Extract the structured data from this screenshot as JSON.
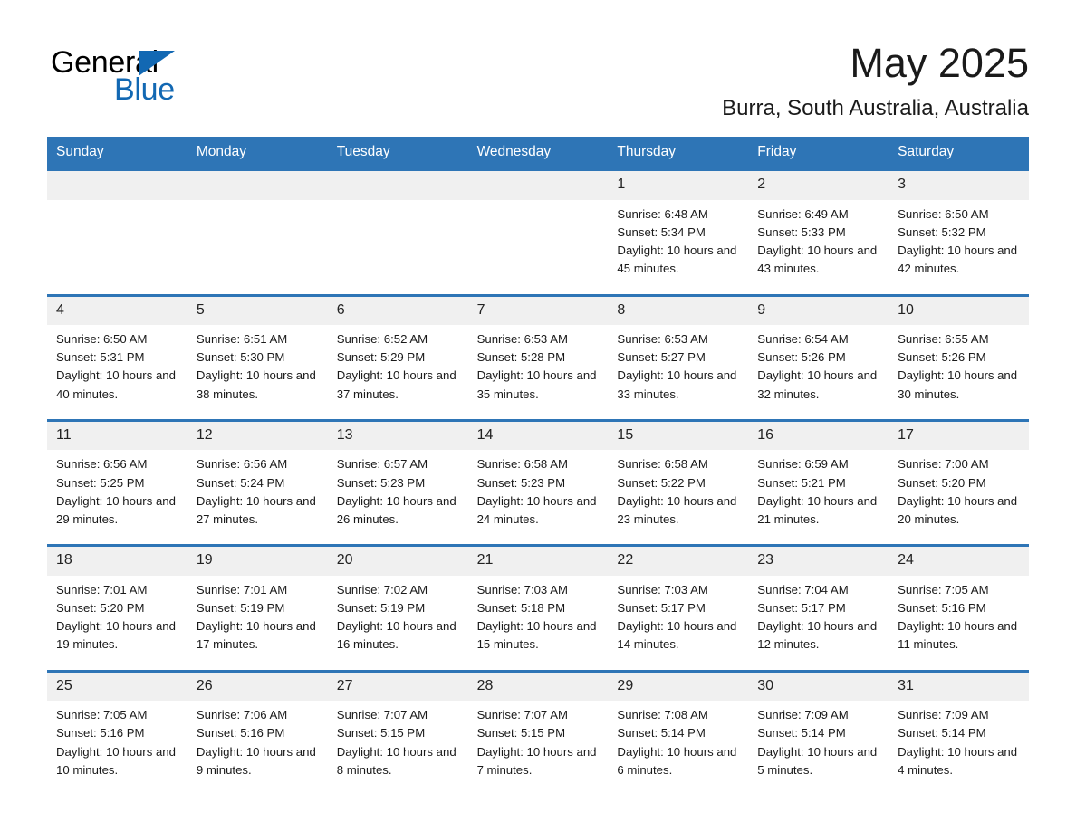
{
  "brand": {
    "name_part1": "General",
    "name_part2": "Blue",
    "triangle_color": "#1268b3"
  },
  "header": {
    "title": "May 2025",
    "subtitle": "Burra, South Australia, Australia"
  },
  "theme": {
    "header_blue": "#2e75b6",
    "daynum_band": "#f0f0f0",
    "text": "#1a1a1a",
    "page_background": "#ffffff"
  },
  "weekdays": [
    "Sunday",
    "Monday",
    "Tuesday",
    "Wednesday",
    "Thursday",
    "Friday",
    "Saturday"
  ],
  "weeks": [
    {
      "days": [
        {
          "number": "",
          "detail": ""
        },
        {
          "number": "",
          "detail": ""
        },
        {
          "number": "",
          "detail": ""
        },
        {
          "number": "",
          "detail": ""
        },
        {
          "number": "1",
          "detail": "Sunrise: 6:48 AM\nSunset: 5:34 PM\nDaylight: 10 hours and 45 minutes."
        },
        {
          "number": "2",
          "detail": "Sunrise: 6:49 AM\nSunset: 5:33 PM\nDaylight: 10 hours and 43 minutes."
        },
        {
          "number": "3",
          "detail": "Sunrise: 6:50 AM\nSunset: 5:32 PM\nDaylight: 10 hours and 42 minutes."
        }
      ]
    },
    {
      "days": [
        {
          "number": "4",
          "detail": "Sunrise: 6:50 AM\nSunset: 5:31 PM\nDaylight: 10 hours and 40 minutes."
        },
        {
          "number": "5",
          "detail": "Sunrise: 6:51 AM\nSunset: 5:30 PM\nDaylight: 10 hours and 38 minutes."
        },
        {
          "number": "6",
          "detail": "Sunrise: 6:52 AM\nSunset: 5:29 PM\nDaylight: 10 hours and 37 minutes."
        },
        {
          "number": "7",
          "detail": "Sunrise: 6:53 AM\nSunset: 5:28 PM\nDaylight: 10 hours and 35 minutes."
        },
        {
          "number": "8",
          "detail": "Sunrise: 6:53 AM\nSunset: 5:27 PM\nDaylight: 10 hours and 33 minutes."
        },
        {
          "number": "9",
          "detail": "Sunrise: 6:54 AM\nSunset: 5:26 PM\nDaylight: 10 hours and 32 minutes."
        },
        {
          "number": "10",
          "detail": "Sunrise: 6:55 AM\nSunset: 5:26 PM\nDaylight: 10 hours and 30 minutes."
        }
      ]
    },
    {
      "days": [
        {
          "number": "11",
          "detail": "Sunrise: 6:56 AM\nSunset: 5:25 PM\nDaylight: 10 hours and 29 minutes."
        },
        {
          "number": "12",
          "detail": "Sunrise: 6:56 AM\nSunset: 5:24 PM\nDaylight: 10 hours and 27 minutes."
        },
        {
          "number": "13",
          "detail": "Sunrise: 6:57 AM\nSunset: 5:23 PM\nDaylight: 10 hours and 26 minutes."
        },
        {
          "number": "14",
          "detail": "Sunrise: 6:58 AM\nSunset: 5:23 PM\nDaylight: 10 hours and 24 minutes."
        },
        {
          "number": "15",
          "detail": "Sunrise: 6:58 AM\nSunset: 5:22 PM\nDaylight: 10 hours and 23 minutes."
        },
        {
          "number": "16",
          "detail": "Sunrise: 6:59 AM\nSunset: 5:21 PM\nDaylight: 10 hours and 21 minutes."
        },
        {
          "number": "17",
          "detail": "Sunrise: 7:00 AM\nSunset: 5:20 PM\nDaylight: 10 hours and 20 minutes."
        }
      ]
    },
    {
      "days": [
        {
          "number": "18",
          "detail": "Sunrise: 7:01 AM\nSunset: 5:20 PM\nDaylight: 10 hours and 19 minutes."
        },
        {
          "number": "19",
          "detail": "Sunrise: 7:01 AM\nSunset: 5:19 PM\nDaylight: 10 hours and 17 minutes."
        },
        {
          "number": "20",
          "detail": "Sunrise: 7:02 AM\nSunset: 5:19 PM\nDaylight: 10 hours and 16 minutes."
        },
        {
          "number": "21",
          "detail": "Sunrise: 7:03 AM\nSunset: 5:18 PM\nDaylight: 10 hours and 15 minutes."
        },
        {
          "number": "22",
          "detail": "Sunrise: 7:03 AM\nSunset: 5:17 PM\nDaylight: 10 hours and 14 minutes."
        },
        {
          "number": "23",
          "detail": "Sunrise: 7:04 AM\nSunset: 5:17 PM\nDaylight: 10 hours and 12 minutes."
        },
        {
          "number": "24",
          "detail": "Sunrise: 7:05 AM\nSunset: 5:16 PM\nDaylight: 10 hours and 11 minutes."
        }
      ]
    },
    {
      "days": [
        {
          "number": "25",
          "detail": "Sunrise: 7:05 AM\nSunset: 5:16 PM\nDaylight: 10 hours and 10 minutes."
        },
        {
          "number": "26",
          "detail": "Sunrise: 7:06 AM\nSunset: 5:16 PM\nDaylight: 10 hours and 9 minutes."
        },
        {
          "number": "27",
          "detail": "Sunrise: 7:07 AM\nSunset: 5:15 PM\nDaylight: 10 hours and 8 minutes."
        },
        {
          "number": "28",
          "detail": "Sunrise: 7:07 AM\nSunset: 5:15 PM\nDaylight: 10 hours and 7 minutes."
        },
        {
          "number": "29",
          "detail": "Sunrise: 7:08 AM\nSunset: 5:14 PM\nDaylight: 10 hours and 6 minutes."
        },
        {
          "number": "30",
          "detail": "Sunrise: 7:09 AM\nSunset: 5:14 PM\nDaylight: 10 hours and 5 minutes."
        },
        {
          "number": "31",
          "detail": "Sunrise: 7:09 AM\nSunset: 5:14 PM\nDaylight: 10 hours and 4 minutes."
        }
      ]
    }
  ]
}
